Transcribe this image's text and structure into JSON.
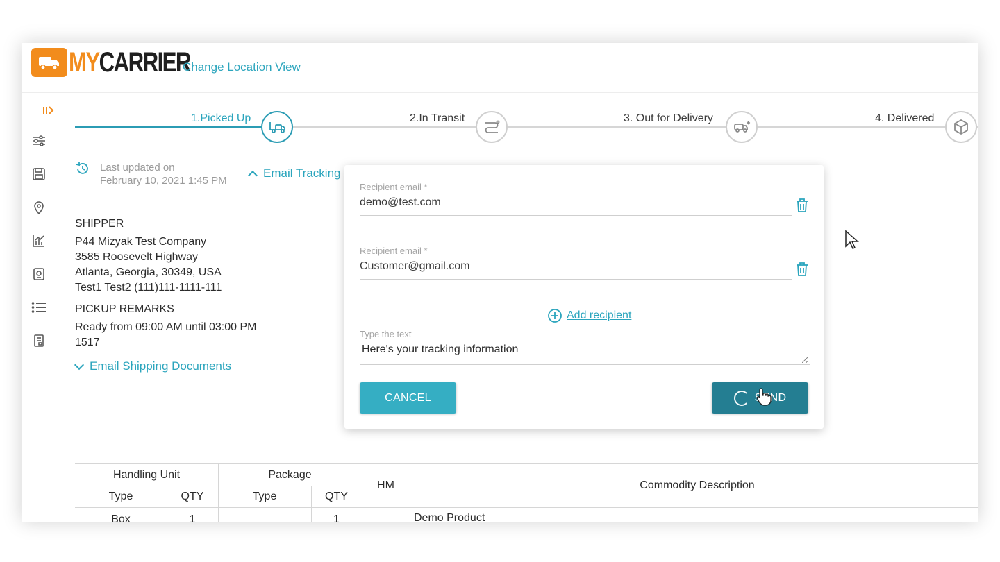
{
  "header": {
    "logo_my": "MY",
    "logo_carrier": "CARRIER",
    "change_location": "Change Location View"
  },
  "sidebar": {
    "items": [
      {
        "icon": "expand-icon"
      },
      {
        "icon": "sliders-icon"
      },
      {
        "icon": "save-icon"
      },
      {
        "icon": "location-pin-icon"
      },
      {
        "icon": "chart-icon"
      },
      {
        "icon": "document-icon"
      },
      {
        "icon": "list-icon"
      },
      {
        "icon": "receipt-icon"
      }
    ]
  },
  "stepper": {
    "steps": [
      {
        "label": "1.Picked Up",
        "icon": "pickup-truck-icon",
        "active": true
      },
      {
        "label": "2.In Transit",
        "icon": "route-icon",
        "active": false
      },
      {
        "label": "3. Out for Delivery",
        "icon": "delivery-truck-icon",
        "active": false
      },
      {
        "label": "4. Delivered",
        "icon": "box-icon",
        "active": false
      }
    ]
  },
  "status": {
    "last_updated_label": "Last updated on",
    "last_updated_value": "February 10, 2021 1:45 PM",
    "email_tracking": "Email Tracking"
  },
  "shipper": {
    "heading": "SHIPPER",
    "company": "P44 Mizyak Test Company",
    "address1": "3585 Roosevelt Highway",
    "address2": "Atlanta, Georgia, 30349, USA",
    "contact": "Test1 Test2 (111)111-1111-111"
  },
  "pickup": {
    "heading": "PICKUP REMARKS",
    "line1": "Ready from 09:00 AM until 03:00 PM",
    "line2": "1517"
  },
  "email_docs": "Email Shipping Documents",
  "popup": {
    "recipients": [
      {
        "label": "Recipient email *",
        "value": "demo@test.com"
      },
      {
        "label": "Recipient email *",
        "value": "Customer@gmail.com"
      }
    ],
    "add_recipient": "Add recipient",
    "message_label": "Type the text",
    "message_value": "Here's your tracking information",
    "cancel": "CANCEL",
    "send": "SEND"
  },
  "table": {
    "group_headers": [
      "Handling Unit",
      "Package"
    ],
    "sub_headers": [
      "Type",
      "QTY",
      "Type",
      "QTY"
    ],
    "hm": "HM",
    "commodity": "Commodity Description",
    "rows": [
      {
        "hu_type": "Box",
        "hu_qty": "1",
        "pkg_type": "",
        "pkg_qty": "1",
        "hm": "",
        "commodity": "Demo Product"
      }
    ]
  },
  "colors": {
    "accent": "#2ba5bd",
    "brand_orange": "#f28c1c",
    "send_button": "#247e92",
    "cancel_button": "#35aec3"
  }
}
